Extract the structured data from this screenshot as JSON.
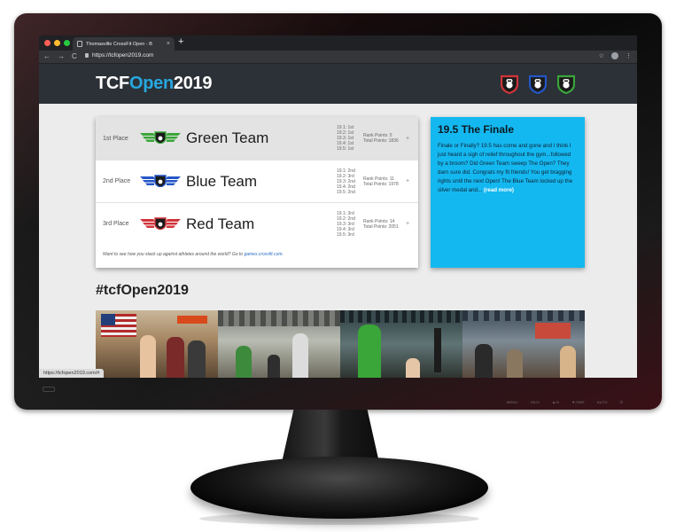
{
  "browser": {
    "tab_title": "Thomasville CrossFit Open - B",
    "tab_close": "×",
    "new_tab": "+",
    "nav_back": "←",
    "nav_forward": "→",
    "nav_reload": "C",
    "url": "https://tcfopen2019.com",
    "bookmark_star": "☆",
    "menu": "⋮",
    "status_url": "https://tcfopen2019.com/#"
  },
  "header": {
    "logo_part1": "TCF",
    "logo_part2": "Open",
    "logo_part3": "2019"
  },
  "standings": {
    "rows": [
      {
        "place": "1st Place",
        "team": "Green Team",
        "color": "#3aa63a",
        "events": [
          "19.1: 1st",
          "19.2: 1st",
          "19.3: 1st",
          "19.4: 1st",
          "19.5: 1st"
        ],
        "rank_points": "Rank Points: 5",
        "total_points": "Total Points: 1836",
        "expand": "+"
      },
      {
        "place": "2nd Place",
        "team": "Blue Team",
        "color": "#2456c7",
        "events": [
          "19.1: 2nd",
          "19.2: 3rd",
          "19.3: 2nd",
          "19.4: 2nd",
          "19.5: 2nd"
        ],
        "rank_points": "Rank Points: 11",
        "total_points": "Total Points: 1978",
        "expand": "+"
      },
      {
        "place": "3rd Place",
        "team": "Red Team",
        "color": "#d0343a",
        "events": [
          "19.1: 3rd",
          "19.2: 2nd",
          "19.3: 3rd",
          "19.4: 3rd",
          "19.5: 3rd"
        ],
        "rank_points": "Rank Points: 14",
        "total_points": "Total Points: 2051",
        "expand": "+"
      }
    ],
    "footnote_text": "Want to see how you stack up against athletes around the world? Go to ",
    "footnote_link": "games.crossfit.com",
    "footnote_end": "."
  },
  "finale": {
    "title": "19.5 The Finale",
    "body": "Finale or Finally? 19.5 has come and gone and I think I just heard a sigh of relief throughout the gym...followed by a broom? Did Green Team sweep The Open? They darn sure did. Congrats my fit friends! You get bragging rights until the next Open! The Blue Team locked up the silver medal and... ",
    "more": "(read more)"
  },
  "hashtag": "#tcfOpen2019",
  "monitor_buttons": [
    "MENU",
    "OK/V",
    "▲/S",
    "▼/OBS",
    "AUTO",
    "⏻"
  ],
  "colors": {
    "accent_blue": "#27a7e0",
    "header_bg": "#2b3137",
    "finale_bg": "#14b8f0",
    "shield_red": "#d0343a",
    "shield_blue": "#2456c7",
    "shield_green": "#3aa63a"
  },
  "icons": [
    "wing-shield-icon",
    "kettlebell-shield-icon",
    "lock-icon",
    "star-icon",
    "avatar-icon"
  ]
}
